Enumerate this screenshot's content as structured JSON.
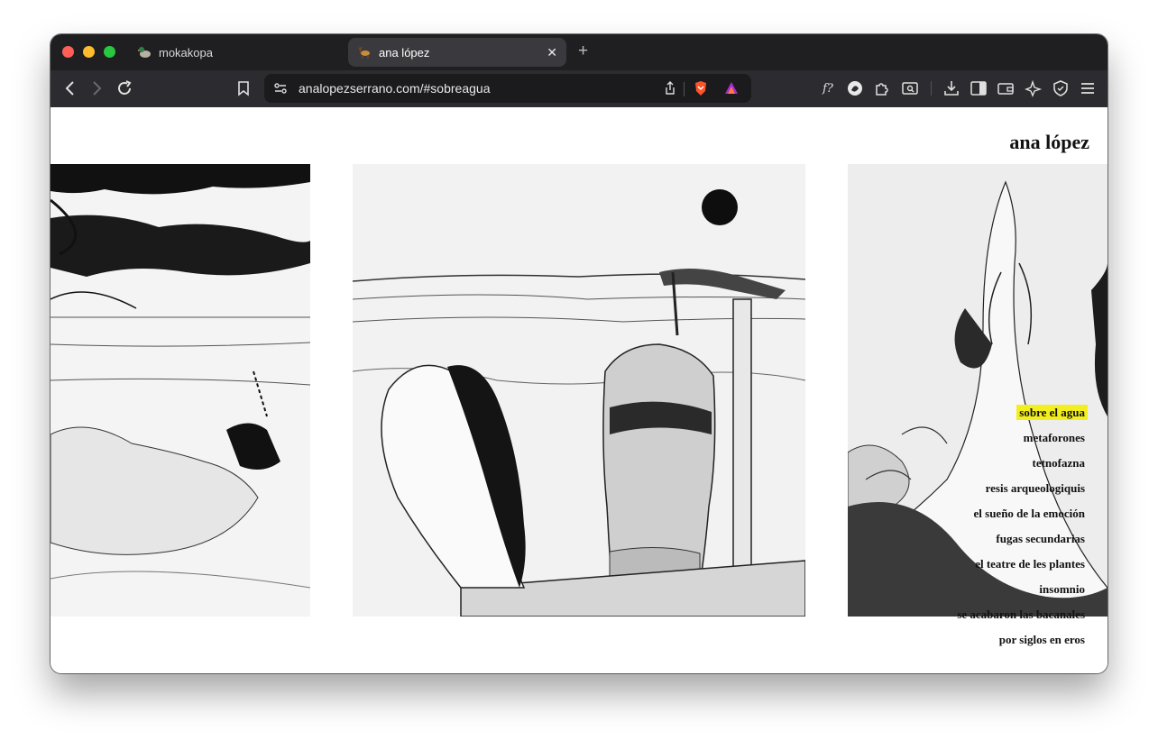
{
  "browser": {
    "tabs": [
      {
        "title": "mokakopa",
        "active": false,
        "icon": "duck-favicon-icon"
      },
      {
        "title": "ana lópez",
        "active": true,
        "icon": "deer-favicon-icon"
      }
    ],
    "url": "analopezserrano.com/#sobreagua"
  },
  "site": {
    "title": "ana lópez",
    "menu": [
      {
        "label": "sobre el agua",
        "active": true
      },
      {
        "label": "metaforones",
        "active": false
      },
      {
        "label": "tetnofazna",
        "active": false
      },
      {
        "label": "resis arqueologiquis",
        "active": false
      },
      {
        "label": "el sueño de la emoción",
        "active": false
      },
      {
        "label": "fugas secundarias",
        "active": false
      },
      {
        "label": "el teatre de les plantes",
        "active": false
      },
      {
        "label": "insomnio",
        "active": false
      },
      {
        "label": "se acabaron las bacanales",
        "active": false
      },
      {
        "label": "por siglos en eros",
        "active": false
      }
    ],
    "highlight_color": "#f2ee1f"
  }
}
